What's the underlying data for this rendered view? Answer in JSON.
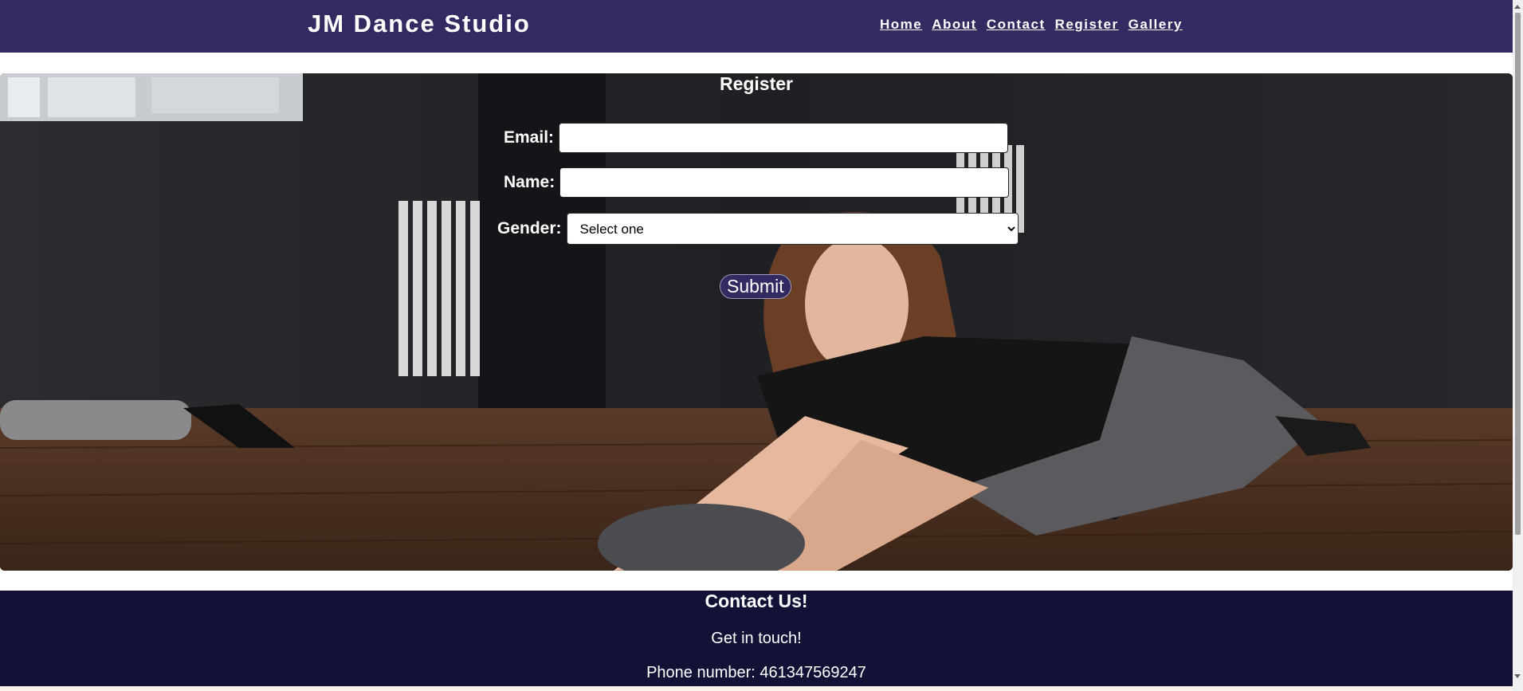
{
  "header": {
    "logo": "JM Dance Studio",
    "nav": [
      "Home",
      "About",
      "Contact",
      "Register",
      "Gallery"
    ]
  },
  "form": {
    "title": "Register",
    "email_label": "Email:",
    "name_label": "Name:",
    "gender_label": "Gender:",
    "gender_selected": "Select one",
    "submit_label": "Submit"
  },
  "footer": {
    "title": "Contact Us!",
    "subtitle": "Get in touch!",
    "phone": "Phone number: 461347569247"
  },
  "colors": {
    "header_bg": "#312b62",
    "footer_bg": "#111236",
    "submit_bg": "#312b62"
  },
  "icons": {
    "scroll_up": "triangle-up-icon",
    "scroll_down": "triangle-down-icon",
    "select_chevron": "chevron-down-icon"
  }
}
